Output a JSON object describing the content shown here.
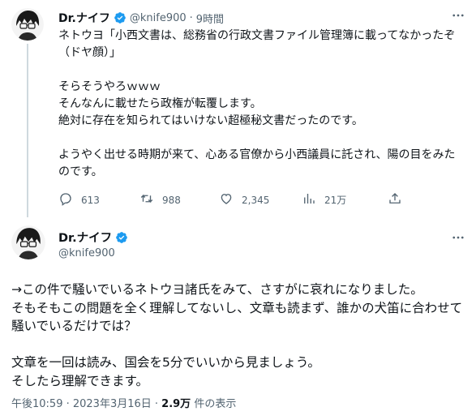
{
  "reply_to": {
    "author_name": "Dr.ナイフ",
    "handle": "@knife900",
    "separator": "·",
    "time_ago": "9時間",
    "text": "ネトウヨ「小西文書は、総務省の行政文書ファイル管理簿に載ってなかったぞ（ドヤ顔）」\n\nそらそうやろｗｗｗ\nそんなんに載せたら政権が転覆します。\n絶対に存在を知られてはいけない超極秘文書だったのです。\n\nようやく出せる時期が来て、心ある官僚から小西議員に託され、陽の目をみたのです。",
    "actions": {
      "replies": "613",
      "retweets": "988",
      "likes": "2,345",
      "views": "21万"
    }
  },
  "main_tweet": {
    "author_name": "Dr.ナイフ",
    "handle": "@knife900",
    "text": "→この件で騒いでいるネトウヨ諸氏をみて、さすがに哀れになりました。\nそもそもこの問題を全く理解してないし、文章も読まず、誰かの犬笛に合わせて騒いでいるだけでは？\n\n文章を一回は読み、国会を5分でいいから見ましょう。\nそしたら理解できます。",
    "timestamp": "午後10:59 · 2023年3月16日 · ",
    "view_count": "2.9万",
    "view_label": " 件の表示"
  },
  "colors": {
    "verified": "#1d9bf0",
    "muted": "#536471",
    "thread_line": "#cfd9de"
  }
}
